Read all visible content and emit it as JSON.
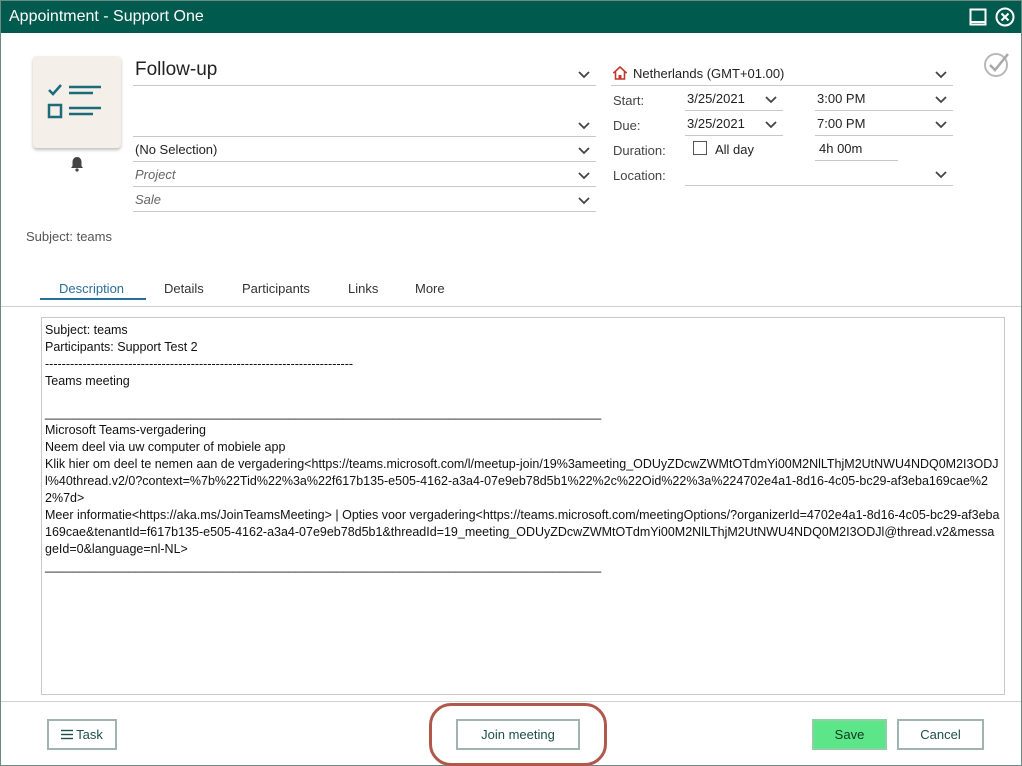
{
  "window": {
    "title": "Appointment - Support One"
  },
  "form": {
    "type_value": "Follow-up",
    "contact_value": "",
    "selection_value": "(No Selection)",
    "project_placeholder": "Project",
    "sale_placeholder": "Sale",
    "timezone": "Netherlands (GMT+01.00)",
    "start_label": "Start:",
    "start_date": "3/25/2021",
    "start_time": "3:00 PM",
    "due_label": "Due:",
    "due_date": "3/25/2021",
    "due_time": "7:00 PM",
    "duration_label": "Duration:",
    "allday_label": "All day",
    "allday_checked": false,
    "duration_value": "4h 00m",
    "location_label": "Location:",
    "location_value": "",
    "subject_line": "Subject: teams"
  },
  "tabs": [
    {
      "label": "Description",
      "active": true
    },
    {
      "label": "Details"
    },
    {
      "label": "Participants"
    },
    {
      "label": "Links"
    },
    {
      "label": "More"
    }
  ],
  "description": {
    "line1": "Subject: teams",
    "line2": "Participants: Support Test 2",
    "line3": "--------------------------------------------------------------------------",
    "line4": "Teams meeting",
    "line5": "",
    "line6": "________________________________________________________________________________",
    "line7": "Microsoft Teams-vergadering",
    "line8": "Neem deel via uw computer of mobiele app",
    "line9": "Klik hier om deel te nemen aan de vergadering<https://teams.microsoft.com/l/meetup-join/19%3ameeting_ODUyZDcwZWMtOTdmYi00M2NlLThjM2UtNWU4NDQ0M2I3ODJl%40thread.v2/0?context=%7b%22Tid%22%3a%22f617b135-e505-4162-a3a4-07e9eb78d5b1%22%2c%22Oid%22%3a%224702e4a1-8d16-4c05-bc29-af3eba169cae%22%7d>",
    "line10": "Meer informatie<https://aka.ms/JoinTeamsMeeting> | Opties voor vergadering<https://teams.microsoft.com/meetingOptions/?organizerId=4702e4a1-8d16-4c05-bc29-af3eba169cae&tenantId=f617b135-e505-4162-a3a4-07e9eb78d5b1&threadId=19_meeting_ODUyZDcwZWMtOTdmYi00M2NlLThjM2UtNWU4NDQ0M2I3ODJl@thread.v2&messageId=0&language=nl-NL>",
    "line11": "________________________________________________________________________________"
  },
  "footer": {
    "task_label": "Task",
    "join_label": "Join meeting",
    "save_label": "Save",
    "cancel_label": "Cancel"
  },
  "colors": {
    "titlebar": "#005a4e",
    "save": "#5de58a",
    "tab_active": "#2a6f98",
    "highlight": "#b0584c"
  }
}
